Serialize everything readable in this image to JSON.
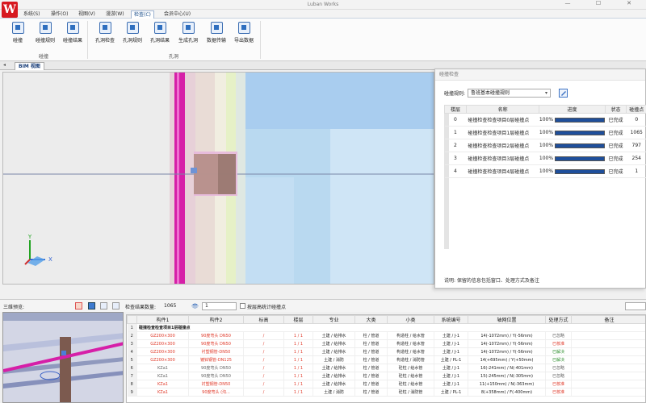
{
  "app": {
    "title": "Luban Works",
    "logo_letter": "W"
  },
  "window_controls": [
    "—",
    "☐",
    "✕"
  ],
  "menu": [
    {
      "label": "系统(S)"
    },
    {
      "label": "操作(O)"
    },
    {
      "label": "视图(V)"
    },
    {
      "label": "漫游(W)"
    },
    {
      "label": "检查(C)",
      "active": true
    },
    {
      "label": "会员中心(U)"
    }
  ],
  "ribbon": {
    "groups": [
      {
        "label": "碰撞",
        "buttons": [
          "碰撞",
          "碰撞规则",
          "碰撞结果"
        ]
      },
      {
        "label": "孔洞",
        "buttons": [
          "孔洞检查",
          "孔洞规则",
          "孔洞结果",
          "生成孔洞",
          "数据传输",
          "导出数据"
        ]
      }
    ]
  },
  "view_tab": {
    "label": "BIM 视图"
  },
  "viewport": {
    "axes": {
      "y": "Y",
      "x": "X",
      "z": "Z"
    }
  },
  "dialog": {
    "title": "碰撞检查",
    "rule_label": "碰撞规则:",
    "rule_value": "鲁班基本碰撞规则",
    "columns": [
      "楼层",
      "名称",
      "进度",
      "状态",
      "碰撞点"
    ],
    "rows": [
      {
        "floor": "0",
        "name": "碰撞检查检查项目0层碰撞点",
        "progress": "100%",
        "progress_value": 1.0,
        "status": "已完成",
        "count": "0"
      },
      {
        "floor": "1",
        "name": "碰撞检查检查项目1层碰撞点",
        "progress": "100%",
        "progress_value": 1.0,
        "status": "已完成",
        "count": "1065"
      },
      {
        "floor": "2",
        "name": "碰撞检查检查项目2层碰撞点",
        "progress": "100%",
        "progress_value": 1.0,
        "status": "已完成",
        "count": "797"
      },
      {
        "floor": "3",
        "name": "碰撞检查检查项目3层碰撞点",
        "progress": "100%",
        "progress_value": 1.0,
        "status": "已完成",
        "count": "254"
      },
      {
        "floor": "4",
        "name": "碰撞检查检查项目4层碰撞点",
        "progress": "100%",
        "progress_value": 1.0,
        "status": "已完成",
        "count": "1"
      }
    ],
    "description": "说明: 保留的信息包括窗口、处理方式及备注"
  },
  "bottom_bar": {
    "preview_label": "三维预览:",
    "result_count_label": "检查结果数量:",
    "result_count": "1065",
    "level_value": "1",
    "level_checkbox_label": "按层高统计碰撞点"
  },
  "results": {
    "columns": [
      "",
      "构件1",
      "构件2",
      "标高",
      "楼层",
      "专业",
      "大类",
      "小类",
      "系统编号",
      "轴网位置",
      "处理方式",
      "备注"
    ],
    "group_row": "碰撞检查检查项目1层碰撞点",
    "rows": [
      {
        "idx": "2",
        "c1": "GZ200×300",
        "c2": "90度弯头 DN50",
        "elev": "/",
        "floor": "1 / 1",
        "major": "土建 / 给排水",
        "big": "柱 / 管道",
        "small": "构造柱 / 给水管",
        "sys": "土建 / J-1",
        "axis": "14(-1072mm) / Y(-56mm)",
        "handle": "已忽略",
        "hclass": "grey",
        "c1class": "red",
        "c2class": "red"
      },
      {
        "idx": "3",
        "c1": "GZ200×300",
        "c2": "90度弯头 DN50",
        "elev": "/",
        "floor": "1 / 1",
        "major": "土建 / 给排水",
        "big": "柱 / 管道",
        "small": "构造柱 / 给水管",
        "sys": "土建 / J-1",
        "axis": "14(-1072mm) / Y(-56mm)",
        "handle": "已核准",
        "hclass": "red",
        "c1class": "red",
        "c2class": "red"
      },
      {
        "idx": "4",
        "c1": "GZ200×300",
        "c2": "衬塑钢管-DN50",
        "elev": "/",
        "floor": "1 / 1",
        "major": "土建 / 给排水",
        "big": "柱 / 管道",
        "small": "构造柱 / 给水管",
        "sys": "土建 / J-1",
        "axis": "14(-1072mm) / Y(-56mm)",
        "handle": "已解决",
        "hclass": "green",
        "c1class": "red",
        "c2class": "red"
      },
      {
        "idx": "5",
        "c1": "GZ200×300",
        "c2": "镀锌钢管-DN125",
        "elev": "/",
        "floor": "1 / 1",
        "major": "土建 / 消防",
        "big": "柱 / 管道",
        "small": "构造柱 / 消防管",
        "sys": "土建 / PL-1",
        "axis": "14(+695mm) / Y(+50mm)",
        "handle": "已解决",
        "hclass": "green",
        "c1class": "red",
        "c2class": "red"
      },
      {
        "idx": "6",
        "c1": "KZa1",
        "c2": "90度弯头 DN50",
        "elev": "/",
        "floor": "1 / 1",
        "major": "土建 / 给排水",
        "big": "柱 / 管道",
        "small": "砼柱 / 给水管",
        "sys": "土建 / J-1",
        "axis": "16(-241mm) / N(-401mm)",
        "handle": "已忽略",
        "hclass": "grey",
        "c1class": "grey",
        "c2class": "grey"
      },
      {
        "idx": "7",
        "c1": "KZa1",
        "c2": "90度弯头 DN50",
        "elev": "/",
        "floor": "1 / 1",
        "major": "土建 / 给排水",
        "big": "柱 / 管道",
        "small": "砼柱 / 给水管",
        "sys": "土建 / J-1",
        "axis": "15(-245mm) / N(-305mm)",
        "handle": "已忽略",
        "hclass": "grey",
        "c1class": "grey",
        "c2class": "grey"
      },
      {
        "idx": "8",
        "c1": "KZa1",
        "c2": "衬塑钢管-DN50",
        "elev": "/",
        "floor": "1 / 1",
        "major": "土建 / 给排水",
        "big": "柱 / 管道",
        "small": "砼柱 / 给水管",
        "sys": "土建 / J-1",
        "axis": "11(+150mm) / N(-363mm)",
        "handle": "已核准",
        "hclass": "red",
        "c1class": "red",
        "c2class": "red"
      },
      {
        "idx": "9",
        "c1": "KZa1",
        "c2": "90度弯头 (沟...",
        "elev": "/",
        "floor": "1 / 1",
        "major": "土建 / 消防",
        "big": "柱 / 管道",
        "small": "砼柱 / 消防管",
        "sys": "土建 / PL-1",
        "axis": "8(+358mm) / F(-400mm)",
        "handle": "已核准",
        "hclass": "red",
        "c1class": "red",
        "c2class": "red"
      }
    ]
  },
  "colors": {
    "accent": "#1f4f9b",
    "pipe": "#d61fa8",
    "brand": "#d71920"
  }
}
